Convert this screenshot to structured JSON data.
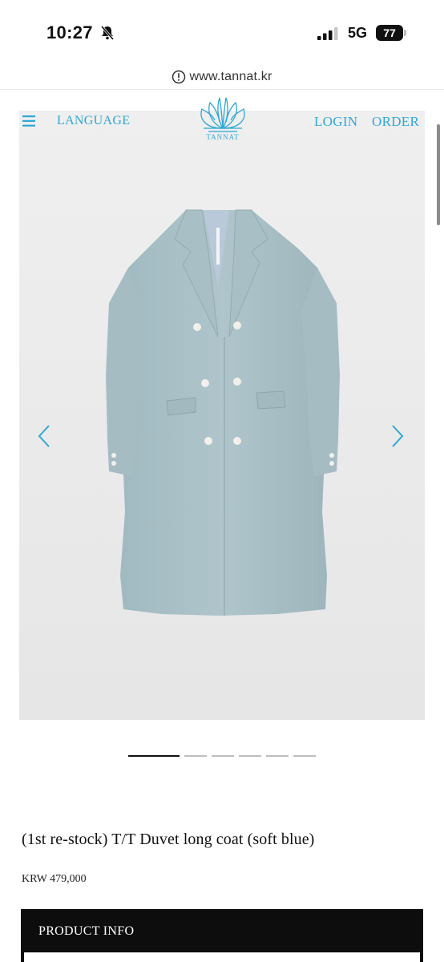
{
  "status_bar": {
    "time": "10:27",
    "network": "5G",
    "battery": "77",
    "icons": [
      "bell-slash-icon",
      "signal-icon",
      "battery-icon"
    ]
  },
  "browser": {
    "url": "www.tannat.kr",
    "icon": "info-icon"
  },
  "header": {
    "menu_icon": "hamburger-menu-icon",
    "language_label": "LANGUAGE",
    "logo_text": "TANNAT",
    "login_label": "LOGIN",
    "order_label": "ORDER",
    "accent_color": "#2fa7d6"
  },
  "gallery": {
    "image_alt": "soft blue double-breasted long coat on hanger",
    "prev_icon": "chevron-left-icon",
    "next_icon": "chevron-right-icon",
    "slide_count": 6,
    "active_slide": 1,
    "coat_color": "#a9c0c7"
  },
  "product": {
    "title": "(1st re-stock) T/T Duvet long coat (soft blue)",
    "price": "KRW 479,000"
  },
  "product_info": {
    "label": "PRODUCT INFO"
  }
}
